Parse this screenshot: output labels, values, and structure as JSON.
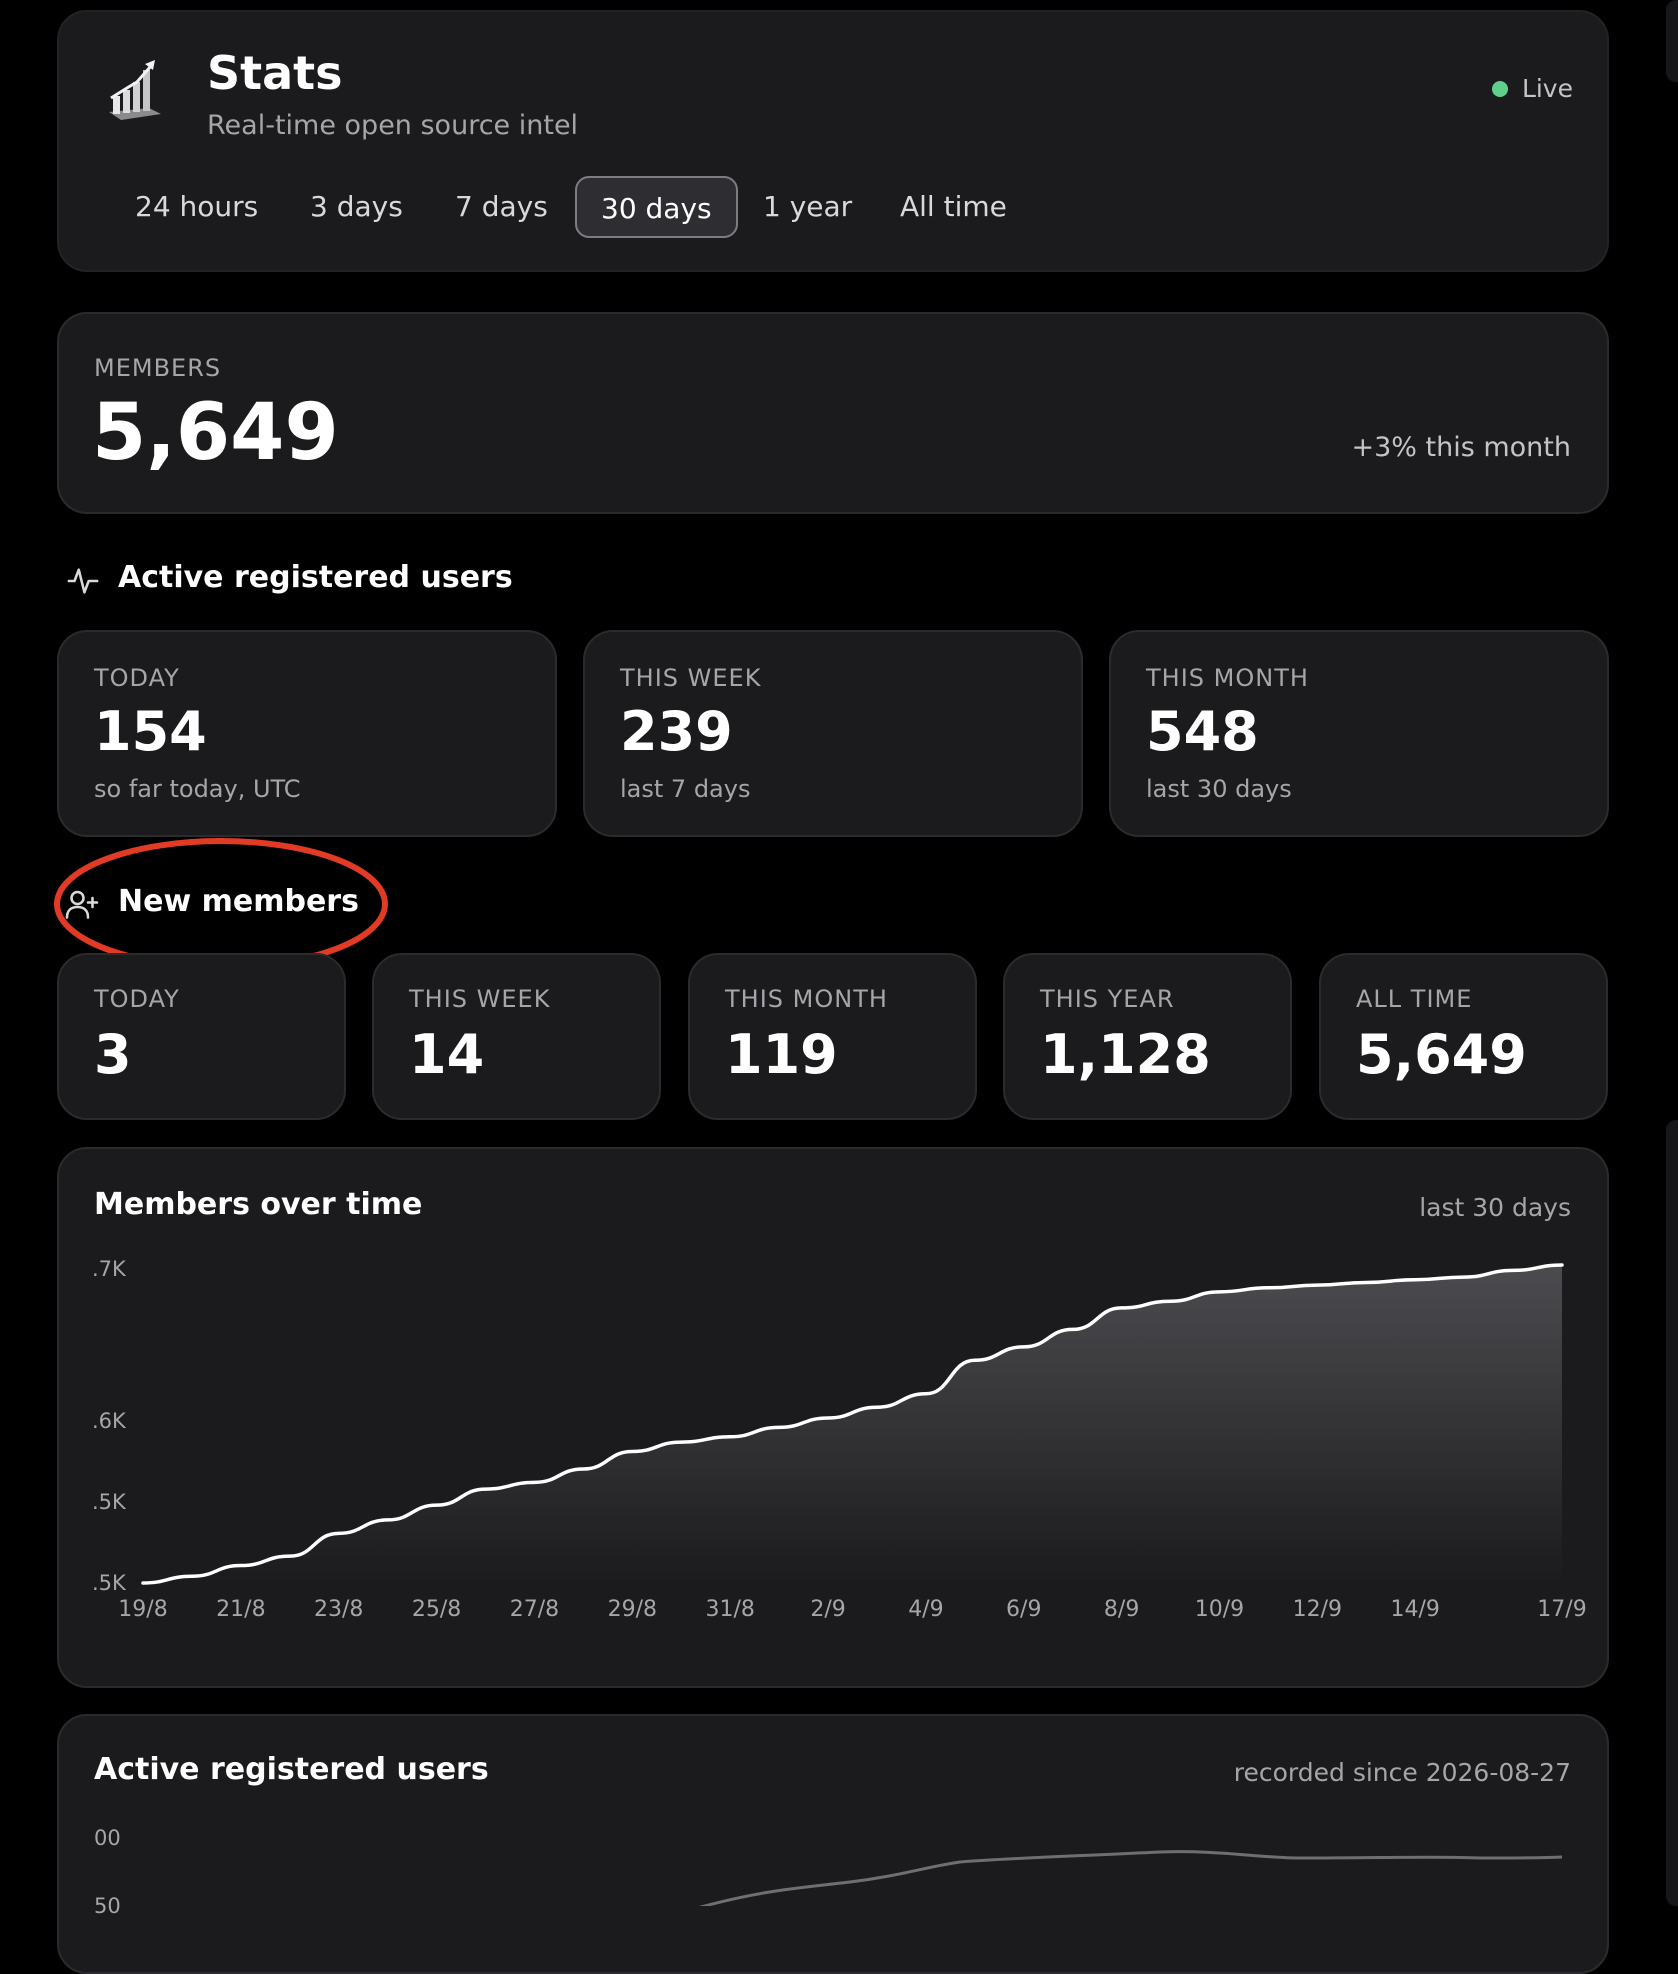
{
  "header": {
    "title": "Stats",
    "subtitle": "Real-time open source intel",
    "live_label": "Live",
    "live_color": "#5fd08c",
    "icon": "bar-chart-3d-icon",
    "ranges": [
      {
        "label": "24 hours",
        "active": false
      },
      {
        "label": "3 days",
        "active": false
      },
      {
        "label": "7 days",
        "active": false
      },
      {
        "label": "30 days",
        "active": true
      },
      {
        "label": "1 year",
        "active": false
      },
      {
        "label": "All time",
        "active": false
      }
    ]
  },
  "members": {
    "label": "MEMBERS",
    "value": "5,649",
    "change": "+3% this month"
  },
  "active_users": {
    "title": "Active registered users",
    "icon": "activity-pulse-icon",
    "cards": [
      {
        "label": "TODAY",
        "value": "154",
        "sub": "so far today, UTC"
      },
      {
        "label": "THIS WEEK",
        "value": "239",
        "sub": "last 7 days"
      },
      {
        "label": "THIS MONTH",
        "value": "548",
        "sub": "last 30 days"
      }
    ]
  },
  "new_members": {
    "title": "New members",
    "icon": "user-plus-icon",
    "annotation_color": "#e23b25",
    "cards": [
      {
        "label": "TODAY",
        "value": "3"
      },
      {
        "label": "THIS WEEK",
        "value": "14"
      },
      {
        "label": "THIS MONTH",
        "value": "119"
      },
      {
        "label": "THIS YEAR",
        "value": "1,128"
      },
      {
        "label": "ALL TIME",
        "value": "5,649"
      }
    ]
  },
  "members_chart": {
    "title": "Members over time",
    "period": "last 30 days"
  },
  "active_chart": {
    "title": "Active registered users",
    "recorded": "recorded since 2026-08-27",
    "y_ticks": [
      "00",
      "50"
    ]
  },
  "chart_data": {
    "type": "area",
    "title": "Members over time",
    "x": [
      "19/8",
      "20/8",
      "21/8",
      "22/8",
      "23/8",
      "24/8",
      "25/8",
      "26/8",
      "27/8",
      "28/8",
      "29/8",
      "30/8",
      "31/8",
      "1/9",
      "2/9",
      "3/9",
      "4/9",
      "5/9",
      "6/9",
      "7/9",
      "8/9",
      "9/9",
      "10/9",
      "11/9",
      "12/9",
      "13/9",
      "14/9",
      "15/9",
      "16/9",
      "17/9"
    ],
    "x_tick_labels": [
      "19/8",
      "21/8",
      "23/8",
      "25/8",
      "27/8",
      "29/8",
      "31/8",
      "2/9",
      "4/9",
      "6/9",
      "8/9",
      "10/9",
      "12/9",
      "14/9",
      "17/9"
    ],
    "series": [
      {
        "values": [
          5460,
          5465,
          5473,
          5480,
          5497,
          5507,
          5518,
          5530,
          5535,
          5545,
          5558,
          5565,
          5569,
          5576,
          5583,
          5591,
          5601,
          5626,
          5636,
          5649,
          5665,
          5670,
          5677,
          5680,
          5682,
          5684,
          5686,
          5688,
          5693,
          5697
        ]
      }
    ],
    "y_tick_labels": [
      ".7K",
      ".6K",
      ".5K",
      ".5K"
    ],
    "ylim": [
      5460,
      5697
    ],
    "grid": false,
    "legend": "none"
  }
}
